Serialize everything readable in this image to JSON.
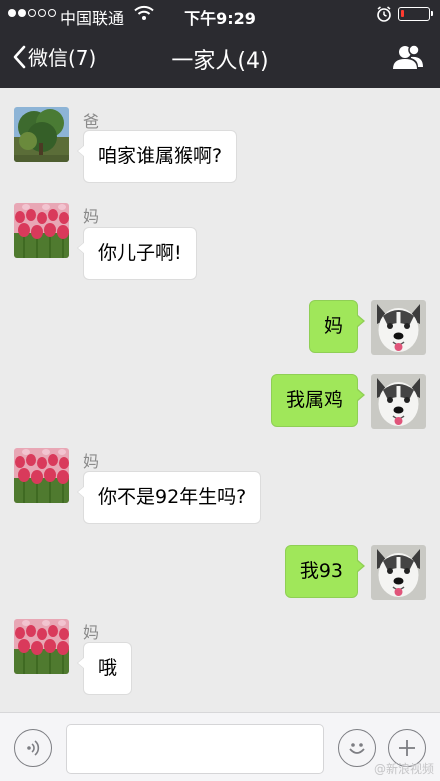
{
  "status_bar": {
    "carrier": "中国联通",
    "time": "下午9:29",
    "signal_bars_filled": 2,
    "signal_bars_total": 5,
    "battery_level": 0.12,
    "battery_color": "#ff3b30",
    "icons": [
      "wifi-icon",
      "alarm-icon",
      "battery-icon"
    ]
  },
  "nav": {
    "back_label": "微信(7)",
    "title": "一家人(4)",
    "right_icon": "group-members-icon"
  },
  "messages": [
    {
      "side": "in",
      "sender": "爸",
      "avatar": "tree-photo",
      "text": "咱家谁属猴啊?"
    },
    {
      "side": "in",
      "sender": "妈",
      "avatar": "tulip-photo",
      "text": "你儿子啊!"
    },
    {
      "side": "out",
      "sender": "",
      "avatar": "husky-photo",
      "text": "妈"
    },
    {
      "side": "out",
      "sender": "",
      "avatar": "husky-photo",
      "text": "我属鸡"
    },
    {
      "side": "in",
      "sender": "妈",
      "avatar": "tulip-photo",
      "text": "你不是92年生吗?"
    },
    {
      "side": "out",
      "sender": "",
      "avatar": "husky-photo",
      "text": "我93"
    },
    {
      "side": "in",
      "sender": "妈",
      "avatar": "tulip-photo",
      "text": "哦"
    }
  ],
  "input_bar": {
    "voice_icon": "voice-icon",
    "emoji_icon": "emoji-icon",
    "plus_icon": "plus-icon",
    "text_value": ""
  },
  "watermark": "@新浪视频",
  "colors": {
    "header_bg": "#2b2b30",
    "chat_bg": "#ebebeb",
    "bubble_out": "#a0e75a",
    "bubble_in": "#ffffff"
  }
}
